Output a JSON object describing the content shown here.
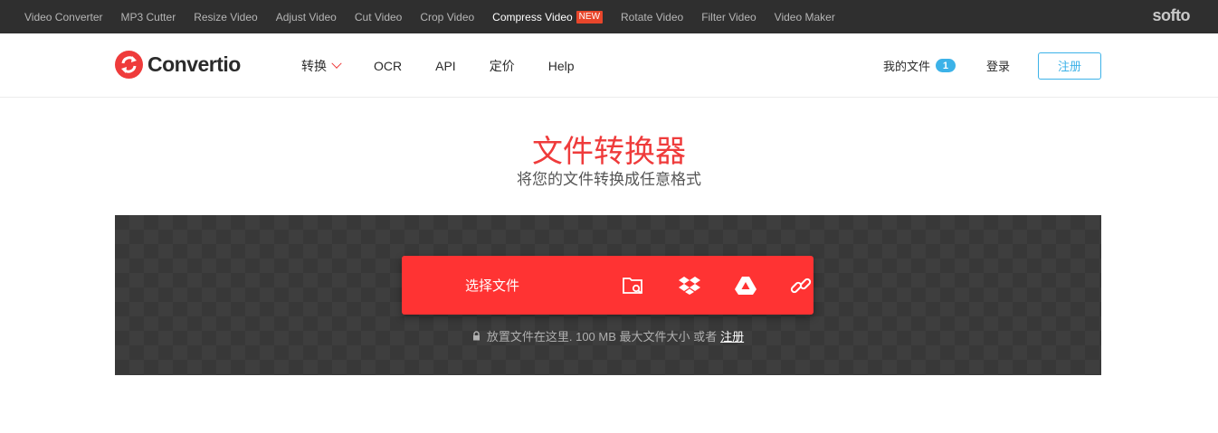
{
  "topbar": {
    "links": [
      {
        "label": "Video Converter"
      },
      {
        "label": "MP3 Cutter"
      },
      {
        "label": "Resize Video"
      },
      {
        "label": "Adjust Video"
      },
      {
        "label": "Cut Video"
      },
      {
        "label": "Crop Video"
      },
      {
        "label": "Compress Video",
        "badge": "NEW"
      },
      {
        "label": "Rotate Video"
      },
      {
        "label": "Filter Video"
      },
      {
        "label": "Video Maker"
      }
    ],
    "brand": "softo"
  },
  "header": {
    "logo_text": "Convertio",
    "nav": [
      "转换",
      "OCR",
      "API",
      "定价",
      "Help"
    ],
    "my_files": "我的文件",
    "my_files_count": "1",
    "login": "登录",
    "signup": "注册"
  },
  "hero": {
    "title": "文件转换器",
    "subtitle": "将您的文件转换成任意格式"
  },
  "upload": {
    "button_label": "选择文件",
    "icons": [
      "folder-search-icon",
      "dropbox-icon",
      "google-drive-icon",
      "link-icon"
    ],
    "hint": "放置文件在这里. 100 MB 最大文件大小 或者",
    "hint_link": "注册"
  },
  "colors": {
    "accent": "#ff3333",
    "blue": "#3cb2e8",
    "topbar": "#2f2f2f",
    "upload_bg": "#383838"
  }
}
